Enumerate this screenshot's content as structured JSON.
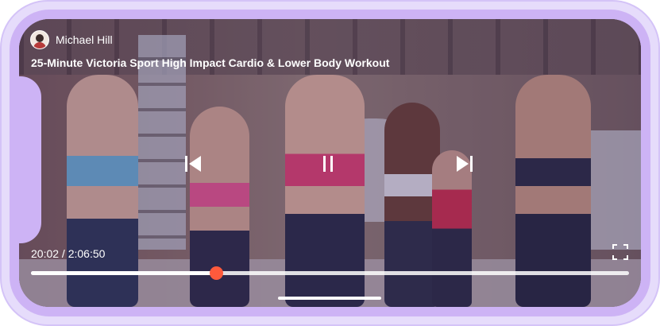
{
  "video": {
    "author": "Michael Hill",
    "title": "25-Minute Victoria Sport High Impact Cardio & Lower Body Workout",
    "time_display": "20:02 / 2:06:50",
    "progress": 0.31
  },
  "controls": {
    "prev_icon": "skip-previous-icon",
    "pause_icon": "pause-icon",
    "next_icon": "skip-next-icon",
    "fullscreen_icon": "fullscreen-icon"
  },
  "colors": {
    "accent": "#ff5a3c",
    "frame": "#cdb3f5",
    "overlay": "#30185a"
  }
}
